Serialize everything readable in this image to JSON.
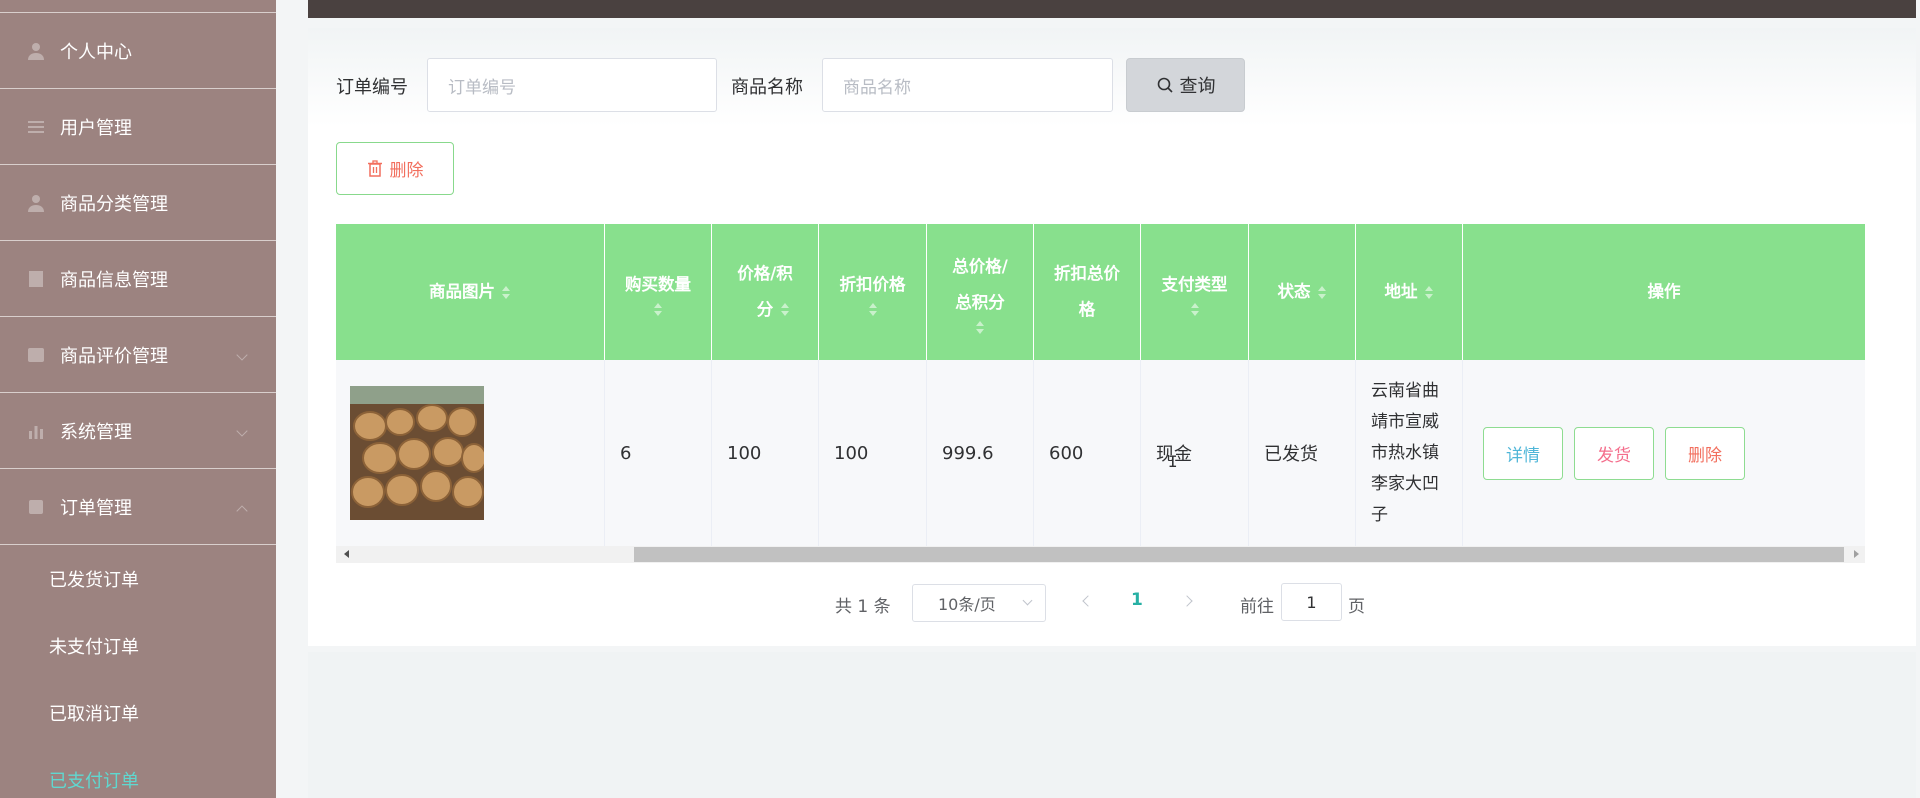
{
  "sidebar": {
    "items": [
      {
        "label": "个人中心",
        "icon": "person-icon"
      },
      {
        "label": "用户管理",
        "icon": "users-icon"
      },
      {
        "label": "商品分类管理",
        "icon": "category-icon"
      },
      {
        "label": "商品信息管理",
        "icon": "goods-icon"
      },
      {
        "label": "商品评价管理",
        "icon": "review-icon"
      },
      {
        "label": "系统管理",
        "icon": "chart-icon"
      },
      {
        "label": "订单管理",
        "icon": "order-icon"
      }
    ],
    "sub_items": [
      "已发货订单",
      "未支付订单",
      "已取消订单",
      "已支付订单"
    ],
    "active_sub_item": "已支付订单",
    "active_color": "#5fd8d0"
  },
  "search": {
    "order_no_label": "订单编号",
    "order_no_placeholder": "订单编号",
    "product_label": "商品名称",
    "product_placeholder": "商品名称",
    "query_button": "查询"
  },
  "toolbar": {
    "delete_button": "删除"
  },
  "table": {
    "header_color": "#88e08d",
    "columns": [
      "商品图片",
      "购买数量",
      "价格/积分",
      "折扣价格",
      "总价格/总积分",
      "折扣总价格",
      "支付类型",
      "状态",
      "地址",
      "操作"
    ],
    "rows": [
      {
        "image": "wood-logs-photo",
        "quantity": "6",
        "price": "100",
        "discount_price": "100",
        "total": "999.6",
        "discount_total": "600",
        "pay_type": "现金",
        "status": "已发货",
        "address": "云南省曲靖市宣威市热水镇李家大凹子",
        "actions": {
          "detail": "详情",
          "ship": "发货",
          "delete": "删除"
        }
      }
    ]
  },
  "pagination": {
    "total_prefix": "共",
    "total": "1",
    "total_suffix": "条",
    "page_size": "10条/页",
    "current_page": "1",
    "goto_prefix": "前往",
    "goto_value": "1",
    "goto_suffix": "页"
  }
}
